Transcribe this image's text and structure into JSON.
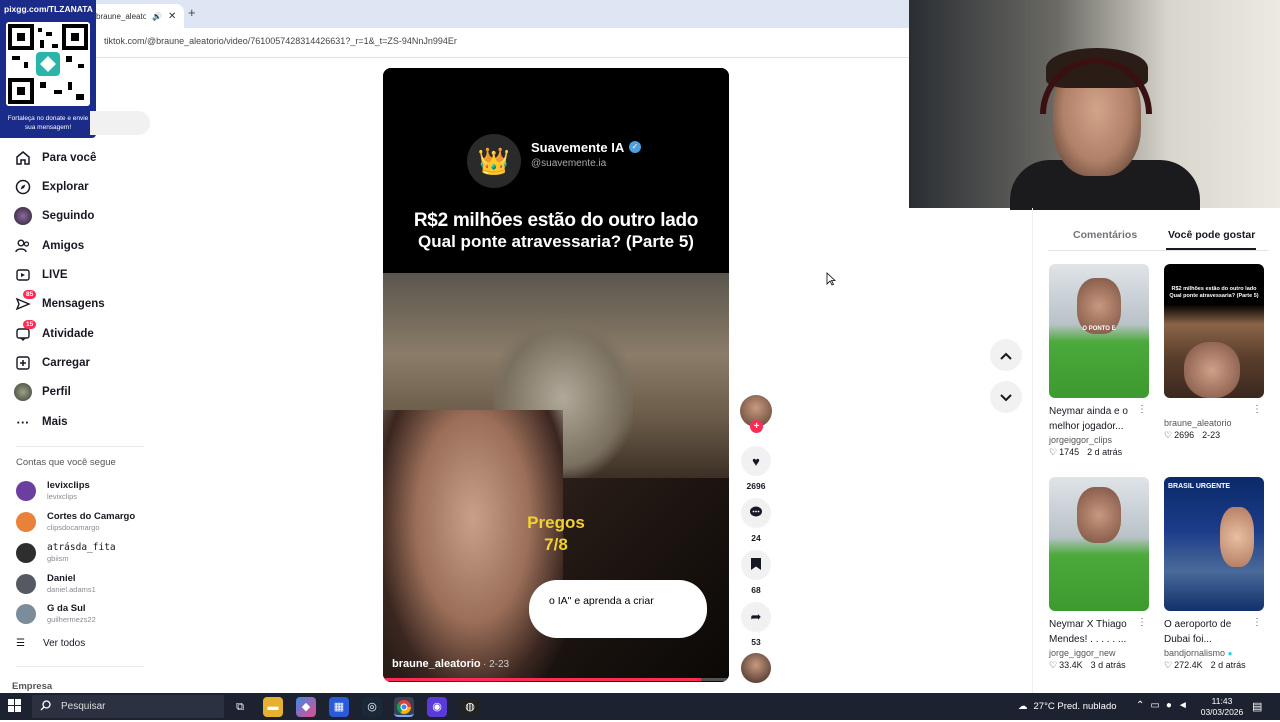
{
  "browser": {
    "tab_title": "braune_aleato",
    "new_tab_label": "+",
    "url": "tiktok.com/@braune_aleatorio/video/7610057428314426631?_r=1&_t=ZS-94NnJn994Er"
  },
  "qr_overlay": {
    "title": "pixgg.com/TLZANATA",
    "caption": "Fortaleça no donate e envie sua mensagem!"
  },
  "sidebar": {
    "nav": [
      {
        "label": "Para você",
        "icon": "home-icon"
      },
      {
        "label": "Explorar",
        "icon": "compass-icon"
      },
      {
        "label": "Seguindo",
        "icon": "following-avatar"
      },
      {
        "label": "Amigos",
        "icon": "friends-icon"
      },
      {
        "label": "LIVE",
        "icon": "live-icon"
      },
      {
        "label": "Mensagens",
        "icon": "messages-icon",
        "badge": "85"
      },
      {
        "label": "Atividade",
        "icon": "activity-icon",
        "badge": "15"
      },
      {
        "label": "Carregar",
        "icon": "upload-icon"
      },
      {
        "label": "Perfil",
        "icon": "profile-avatar"
      },
      {
        "label": "Mais",
        "icon": "more-icon"
      }
    ],
    "following_label": "Contas que você segue",
    "accounts": [
      {
        "name": "levixclips",
        "handle": "levixclips",
        "color": "#6b3fa0"
      },
      {
        "name": "Cortes do Camargo",
        "handle": "clipsdocamargo",
        "color": "#e8823a"
      },
      {
        "name": "atrásda_fita",
        "handle": "gbiism",
        "color": "#2e2e2e"
      },
      {
        "name": "Daniel",
        "handle": "daniel.adams1",
        "color": "#555a62"
      },
      {
        "name": "G da Sul",
        "handle": "guilhermezs22",
        "color": "#7b8c9a"
      }
    ],
    "see_all": "Ver todos",
    "footer_label": "Empresa"
  },
  "video": {
    "channel_name": "Suavemente IA",
    "channel_handle": "@suavemente.ia",
    "headline_line1": "R$2 milhões estão do outro lado",
    "headline_line2": "Qual ponte atravessaria? (Parte 5)",
    "pregos_line1": "Pregos",
    "pregos_line2": "7/8",
    "cta_text": "o IA\" e aprenda a criar",
    "author": "braune_aleatorio",
    "date": "· 2-23",
    "progress": 0.92
  },
  "actions": {
    "likes": "2696",
    "comments": "24",
    "saves": "68",
    "shares": "53"
  },
  "right_panel": {
    "tab_comments": "Comentários",
    "tab_suggested": "Você pode gostar",
    "cards": [
      {
        "title": "Neymar ainda e o melhor jogador...",
        "user": "jorgeiggor_clips",
        "likes": "1745",
        "date": "2 d atrás",
        "thumb_text": "O PONTO E"
      },
      {
        "title": "",
        "user": "braune_aleatorio",
        "likes": "2696",
        "date": "2-23",
        "thumb_text": "R$2 milhões estão do outro lado Qual ponte atravessaria? (Parte 5)"
      },
      {
        "title": "Neymar X Thiago Mendes! . . . . . ...",
        "user": "jorge_iggor_new",
        "likes": "33.4K",
        "date": "3 d atrás",
        "thumb_text": ""
      },
      {
        "title": "O aeroporto de Dubai foi...",
        "user": "bandjornalismo",
        "likes": "272.4K",
        "date": "2 d atrás",
        "thumb_text": "BRASIL URGENTE"
      }
    ]
  },
  "taskbar": {
    "search_placeholder": "Pesquisar",
    "weather": "27°C  Pred. nublado",
    "time": "11:43",
    "date": "03/03/2026"
  }
}
